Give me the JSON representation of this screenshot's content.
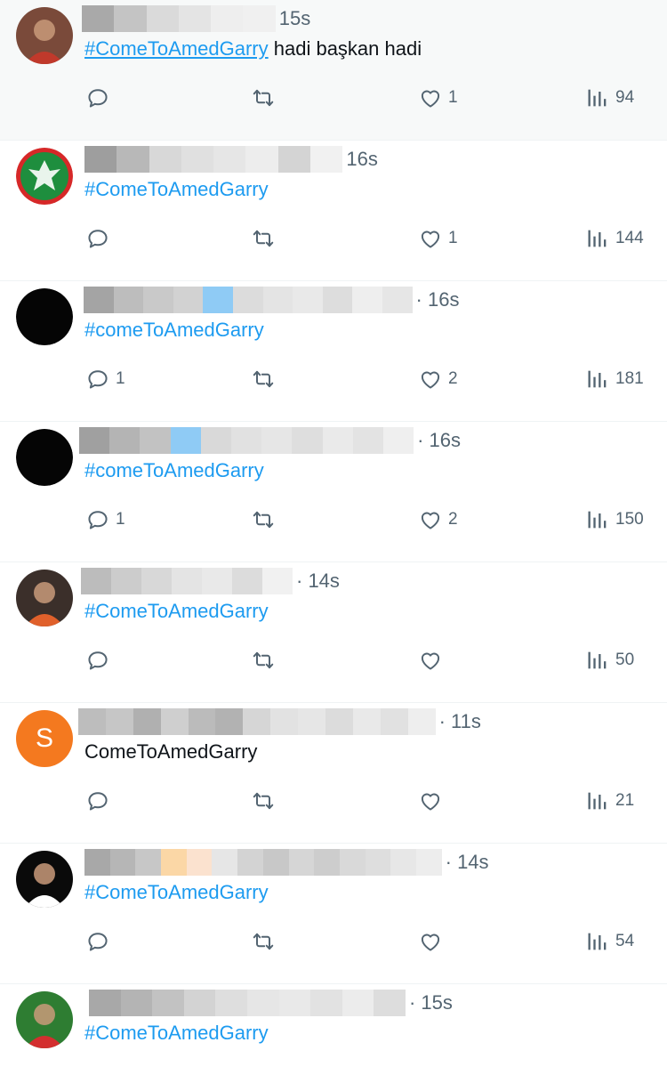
{
  "tweets": [
    {
      "avatar": {
        "kind": "photo",
        "icon": "person-photo-avatar",
        "bg": "#7a4a3a",
        "fg": "#c0392b"
      },
      "name_blur": [
        "#a9a9a9",
        "#c4c4c4",
        "#dadada",
        "#e4e4e4",
        "#eeeeee",
        "#f0f0f0"
      ],
      "meta": "15s",
      "hashtag": "#ComeToAmedGarry",
      "body": " hadi başkan hadi",
      "hashtag_underlined": true,
      "reply": "",
      "retweet": "",
      "like": "1",
      "views": "94"
    },
    {
      "avatar": {
        "kind": "logo",
        "icon": "club-crest-avatar",
        "bg": "#1e8e3e",
        "fg": "#d62828"
      },
      "name_blur": [
        "#9e9e9e",
        "#b8b8b8",
        "#d8d8d8",
        "#e0e0e0",
        "#e6e6e6",
        "#ededed",
        "#d4d4d4",
        "#f1f1f1"
      ],
      "meta": "16s",
      "hashtag": "#ComeToAmedGarry",
      "body": "",
      "hashtag_underlined": false,
      "reply": "",
      "retweet": "",
      "like": "1",
      "views": "144"
    },
    {
      "avatar": {
        "kind": "solid",
        "icon": "black-avatar",
        "bg": "#050505",
        "fg": "#050505"
      },
      "name_blur": [
        "#a4a4a4",
        "#bdbdbd",
        "#c9c9c9",
        "#d2d2d2",
        "#8fcbf5",
        "#dcdcdc",
        "#e4e4e4",
        "#e9e9e9",
        "#dddddd",
        "#eeeeee",
        "#e6e6e6"
      ],
      "meta": "· 16s",
      "hashtag": "#comeToAmedGarry",
      "body": "",
      "hashtag_underlined": false,
      "reply": "1",
      "retweet": "",
      "like": "2",
      "views": "181"
    },
    {
      "avatar": {
        "kind": "solid",
        "icon": "black-avatar",
        "bg": "#050505",
        "fg": "#050505"
      },
      "name_blur": [
        "#a0a0a0",
        "#b4b4b4",
        "#c2c2c2",
        "#8fcbf5",
        "#d9d9d9",
        "#e1e1e1",
        "#e6e6e6",
        "#dedede",
        "#eaeaea",
        "#e3e3e3",
        "#efefef"
      ],
      "meta": "· 16s",
      "hashtag": "#comeToAmedGarry",
      "body": "",
      "hashtag_underlined": false,
      "reply": "1",
      "retweet": "",
      "like": "2",
      "views": "150"
    },
    {
      "avatar": {
        "kind": "photo",
        "icon": "eagle-photo-avatar",
        "bg": "#3b2f2a",
        "fg": "#e0602b"
      },
      "name_blur": [
        "#bcbcbc",
        "#cccccc",
        "#d8d8d8",
        "#e4e4e4",
        "#e9e9e9",
        "#dcdcdc",
        "#f1f1f1"
      ],
      "meta": "· 14s",
      "hashtag": "#ComeToAmedGarry",
      "body": "",
      "hashtag_underlined": false,
      "reply": "",
      "retweet": "",
      "like": "",
      "views": "50"
    },
    {
      "avatar": {
        "kind": "letter",
        "icon": "letter-avatar",
        "letter": "S",
        "bg": "#f4791f",
        "fg": "#ffffff"
      },
      "name_blur": [
        "#bdbdbd",
        "#c6c6c6",
        "#b0b0b0",
        "#cfcfcf",
        "#bbbbbb",
        "#b2b2b2",
        "#d6d6d6",
        "#e2e2e2",
        "#e6e6e6",
        "#dcdcdc",
        "#e9e9e9",
        "#e1e1e1",
        "#eeeeee"
      ],
      "meta": "· 11s",
      "hashtag": "",
      "body": "ComeToAmedGarry",
      "hashtag_underlined": false,
      "reply": "",
      "retweet": "",
      "like": "",
      "views": "21"
    },
    {
      "avatar": {
        "kind": "photo",
        "icon": "silhouette-photo-avatar",
        "bg": "#0a0a0a",
        "fg": "#ffffff"
      },
      "name_blur": [
        "#a8a8a8",
        "#b6b6b6",
        "#c7c7c7",
        "#fbd7a6",
        "#fbe2cf",
        "#e6e6e6",
        "#d3d3d3",
        "#c8c8c8",
        "#d6d6d6",
        "#cdcdcd",
        "#d9d9d9",
        "#dedede",
        "#e7e7e7",
        "#ededed"
      ],
      "meta": "· 14s",
      "hashtag": "#ComeToAmedGarry",
      "body": "",
      "hashtag_underlined": false,
      "reply": "",
      "retweet": "",
      "like": "",
      "views": "54"
    },
    {
      "avatar": {
        "kind": "photo",
        "icon": "flag-photo-avatar",
        "bg": "#2e7d32",
        "fg": "#d32f2f"
      },
      "name_blur": [
        "#a8a8a8",
        "#b4b4b4",
        "#c2c2c2",
        "#d3d3d3",
        "#dedede",
        "#e6e6e6",
        "#e9e9e9",
        "#e2e2e2",
        "#ececec",
        "#dddddd"
      ],
      "meta": "· 15s",
      "hashtag": "#ComeToAmedGarry",
      "body": "",
      "hashtag_underlined": false,
      "reply": "",
      "retweet": "",
      "like": "",
      "views": ""
    }
  ],
  "colors": {
    "hashtag": "#1d9bf0",
    "muted": "#536471",
    "divider": "#eff3f4"
  }
}
